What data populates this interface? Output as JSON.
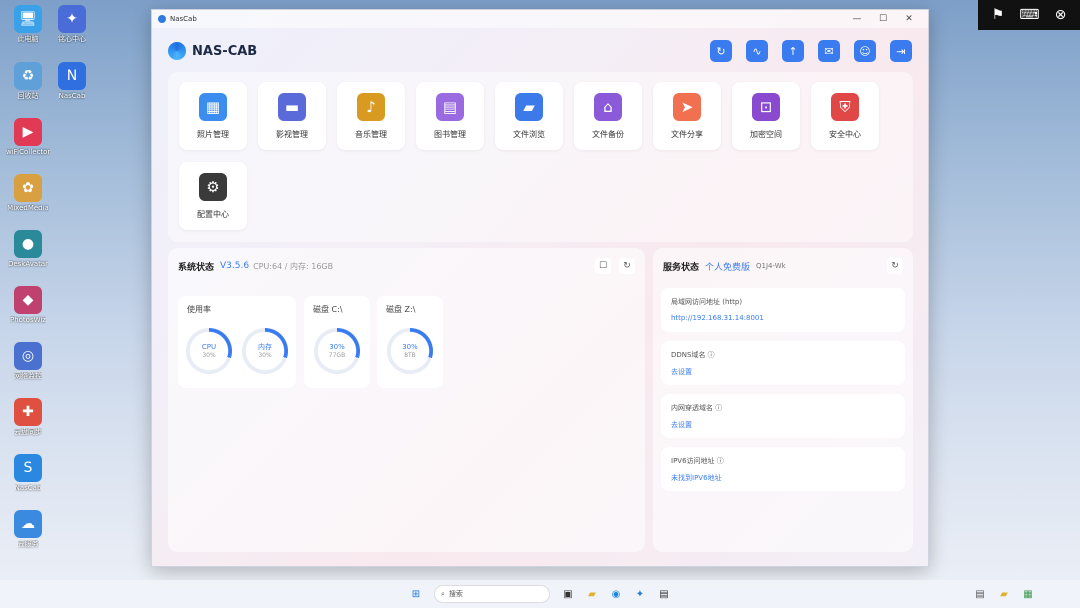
{
  "desktop": {
    "icons": [
      {
        "label": "此电脑",
        "glyph": "🖥",
        "color": "#3aa0e8"
      },
      {
        "label": "铭心中心",
        "glyph": "✦",
        "color": "#4a6cd8"
      },
      {
        "label": "回收站",
        "glyph": "♻",
        "color": "#5fa0d8"
      },
      {
        "label": "NasCab",
        "glyph": "N",
        "color": "#2f6fe0"
      },
      {
        "label": "wiFiCollector",
        "glyph": "▶",
        "color": "#e03a55"
      },
      {
        "label": "MixedMedia",
        "glyph": "✿",
        "color": "#d8a040"
      },
      {
        "label": "DeskAvatar",
        "glyph": "●",
        "color": "#2a8a9a"
      },
      {
        "label": "PhotosWiz",
        "glyph": "◆",
        "color": "#c04070"
      },
      {
        "label": "网络监控",
        "glyph": "◎",
        "color": "#4a70d0"
      },
      {
        "label": "云盘同步",
        "glyph": "✚",
        "color": "#e05040"
      },
      {
        "label": "NasCab",
        "glyph": "S",
        "color": "#2a88e0"
      },
      {
        "label": "云服务",
        "glyph": "☁",
        "color": "#3a8ae0"
      }
    ]
  },
  "overlay": {
    "icons": [
      "flag-icon",
      "keyboard-icon",
      "close-icon"
    ]
  },
  "window": {
    "title": "NasCab",
    "brand": "NAS-CAB",
    "toolbar": [
      {
        "name": "refresh-icon",
        "glyph": "↻"
      },
      {
        "name": "pulse-icon",
        "glyph": "∿"
      },
      {
        "name": "upload-icon",
        "glyph": "↑"
      },
      {
        "name": "mail-icon",
        "glyph": "✉"
      },
      {
        "name": "user-icon",
        "glyph": "☺"
      },
      {
        "name": "logout-icon",
        "glyph": "⇥"
      }
    ],
    "apps": [
      {
        "label": "照片管理",
        "glyph": "▦",
        "color": "#3b8df0"
      },
      {
        "label": "影视管理",
        "glyph": "▬",
        "color": "#5a6ad8"
      },
      {
        "label": "音乐管理",
        "glyph": "♪",
        "color": "#d89a20"
      },
      {
        "label": "图书管理",
        "glyph": "▤",
        "color": "#9a6ae0"
      },
      {
        "label": "文件浏览",
        "glyph": "▰",
        "color": "#3b7ae8"
      },
      {
        "label": "文件备份",
        "glyph": "⌂",
        "color": "#8a5ad8"
      },
      {
        "label": "文件分享",
        "glyph": "➤",
        "color": "#f07050"
      },
      {
        "label": "加密空间",
        "glyph": "⊡",
        "color": "#8a4ad0"
      },
      {
        "label": "安全中心",
        "glyph": "⛨",
        "color": "#e04848"
      },
      {
        "label": "配置中心",
        "glyph": "⚙",
        "color": "#3a3a3a"
      }
    ],
    "system": {
      "title": "系统状态",
      "version": "V3.5.6",
      "spec": "CPU:64 / 内存: 16GB",
      "usage": {
        "title": "使用率",
        "cpu_label": "CPU",
        "cpu_value": "30%",
        "mem_label": "内存",
        "mem_value": "30%",
        "cpu_pct": 0.3,
        "mem_pct": 0.3
      },
      "disk_c": {
        "title": "磁盘 C:\\",
        "label": "30%",
        "value": "77GB",
        "pct": 0.3
      },
      "disk_z": {
        "title": "磁盘 Z:\\",
        "label": "30%",
        "value": "8TB",
        "pct": 0.3
      }
    },
    "service": {
      "title": "服务状态",
      "plan": "个人免费版",
      "code": "Q1J4-Wk",
      "rows": [
        {
          "label": "局域网访问地址  (http)",
          "value": "http://192.168.31.14:8001"
        },
        {
          "label": "DDNS域名  ⓘ",
          "value": "去设置"
        },
        {
          "label": "内网穿透域名  ⓘ",
          "value": "去设置"
        },
        {
          "label": "IPV6访问地址  ⓘ",
          "value": "未找到IPV6地址"
        }
      ]
    }
  },
  "taskbar": {
    "search_placeholder": "搜索"
  }
}
